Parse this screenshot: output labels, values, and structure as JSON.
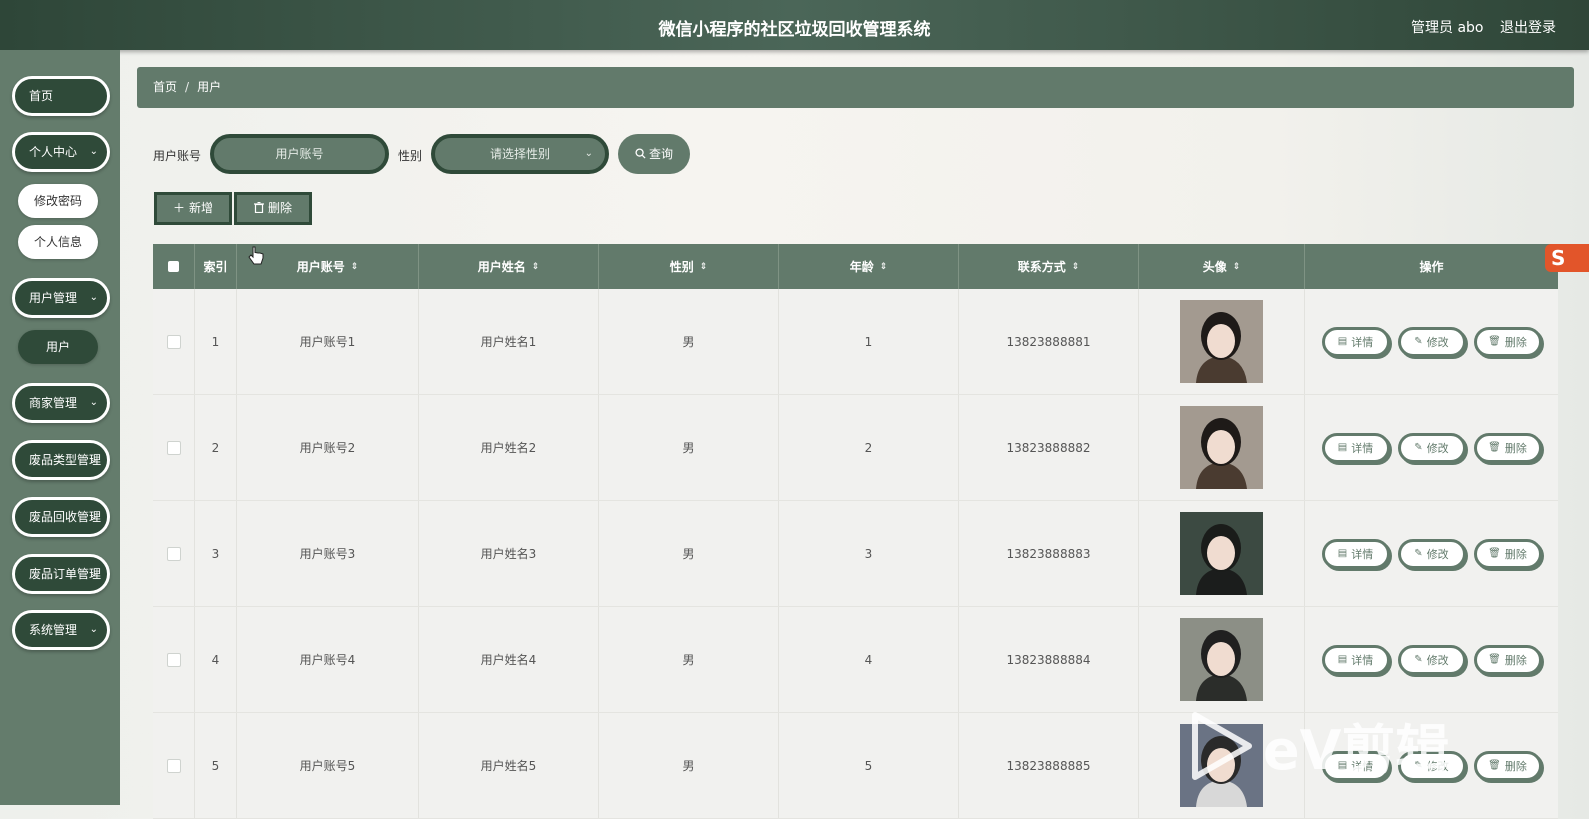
{
  "header": {
    "title": "微信小程序的社区垃圾回收管理系统",
    "admin": "管理员 abo",
    "logout": "退出登录"
  },
  "sidebar": {
    "items": [
      {
        "label": "首页"
      },
      {
        "label": "个人中心",
        "chevron": "⌄"
      },
      {
        "label": "修改密码"
      },
      {
        "label": "个人信息"
      },
      {
        "label": "用户管理",
        "chevron": "⌄"
      },
      {
        "label": "用户"
      },
      {
        "label": "商家管理",
        "chevron": "⌄"
      },
      {
        "label": "废品类型管理",
        "chevron": "⌄"
      },
      {
        "label": "废品回收管理",
        "chevron": "⌄"
      },
      {
        "label": "废品订单管理",
        "chevron": "⌄"
      },
      {
        "label": "系统管理",
        "chevron": "⌄"
      }
    ]
  },
  "breadcrumb": {
    "home": "首页",
    "sep": "/",
    "current": "用户"
  },
  "search": {
    "account_label": "用户账号",
    "account_placeholder": "用户账号",
    "gender_label": "性别",
    "gender_placeholder": "请选择性别",
    "query_button": "查询"
  },
  "actions": {
    "add": "新增",
    "delete": "删除"
  },
  "table": {
    "headers": [
      "索引",
      "用户账号",
      "用户姓名",
      "性别",
      "年龄",
      "联系方式",
      "头像",
      "操作"
    ],
    "rows": [
      {
        "index": "1",
        "account": "用户账号1",
        "name": "用户姓名1",
        "gender": "男",
        "age": "1",
        "phone": "13823888881"
      },
      {
        "index": "2",
        "account": "用户账号2",
        "name": "用户姓名2",
        "gender": "男",
        "age": "2",
        "phone": "13823888882"
      },
      {
        "index": "3",
        "account": "用户账号3",
        "name": "用户姓名3",
        "gender": "男",
        "age": "3",
        "phone": "13823888883"
      },
      {
        "index": "4",
        "account": "用户账号4",
        "name": "用户姓名4",
        "gender": "男",
        "age": "4",
        "phone": "13823888884"
      },
      {
        "index": "5",
        "account": "用户账号5",
        "name": "用户姓名5",
        "gender": "男",
        "age": "5",
        "phone": "13823888885"
      }
    ],
    "row_actions": {
      "detail": "详情",
      "edit": "修改",
      "delete": "删除"
    }
  },
  "watermark": "eV剪辑",
  "colors": {
    "primary": "#627a6b",
    "dark": "#2f4a39",
    "header": "#3d5546",
    "sidebar": "#647c6c"
  }
}
